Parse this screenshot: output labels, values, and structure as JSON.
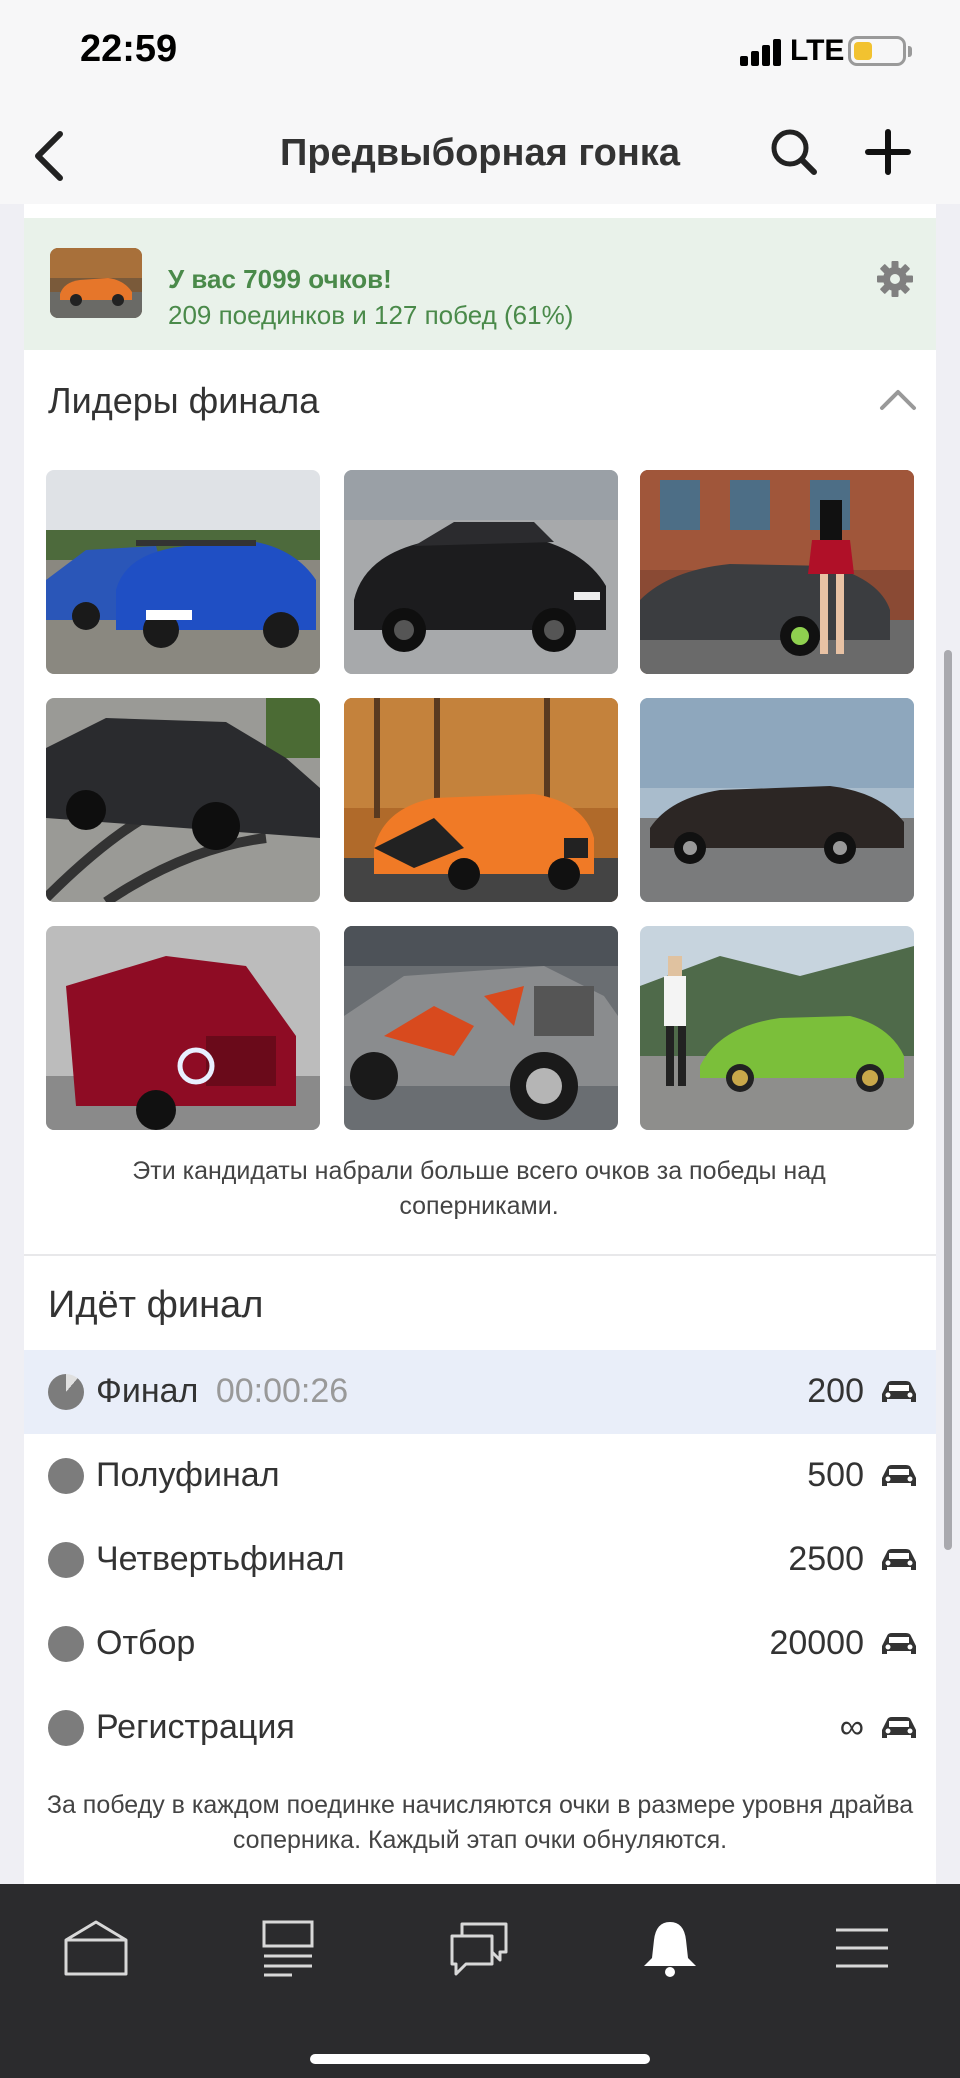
{
  "status_bar": {
    "time": "22:59",
    "network": "LTE"
  },
  "nav": {
    "title": "Предвыборная гонка",
    "back_icon": "chevron-left-icon",
    "search_icon": "search-icon",
    "add_icon": "plus-icon"
  },
  "score": {
    "title": "У вас 7099 очков!",
    "subtitle": "209 поединков и 127 побед (61%)",
    "settings_icon": "gear-icon"
  },
  "leaders": {
    "title": "Лидеры финала",
    "note": "Эти кандидаты набрали больше всего очков за победы над соперниками.",
    "photos": [
      "blue-subaru-photo",
      "black-challenger-photo",
      "skoda-girl-photo",
      "black-sedan-photo",
      "orange-audi-photo",
      "dark-accord-photo",
      "red-pickup-photo",
      "camo-tundra-photo",
      "green-hatchback-photo"
    ]
  },
  "final": {
    "title": "Идёт финал",
    "stages": [
      {
        "name": "Финал",
        "timer": "00:00:26",
        "value": "200",
        "active": true
      },
      {
        "name": "Полуфинал",
        "timer": "",
        "value": "500",
        "active": false
      },
      {
        "name": "Четвертьфинал",
        "timer": "",
        "value": "2500",
        "active": false
      },
      {
        "name": "Отбор",
        "timer": "",
        "value": "20000",
        "active": false
      },
      {
        "name": "Регистрация",
        "timer": "",
        "value": "∞",
        "active": false
      }
    ],
    "note": "За победу в каждом поединке начисляются очки в размере уровня драйва соперника. Каждый этап очки обнуляются."
  },
  "tab_bar": {
    "tabs": [
      "home-icon",
      "feed-icon",
      "chat-icon",
      "bell-icon",
      "menu-icon"
    ],
    "active_tab": "bell-icon"
  },
  "colors": {
    "accent_green": "#4a8a4a",
    "active_row": "#e9eef9",
    "tab_bar": "#2b2b2d"
  }
}
